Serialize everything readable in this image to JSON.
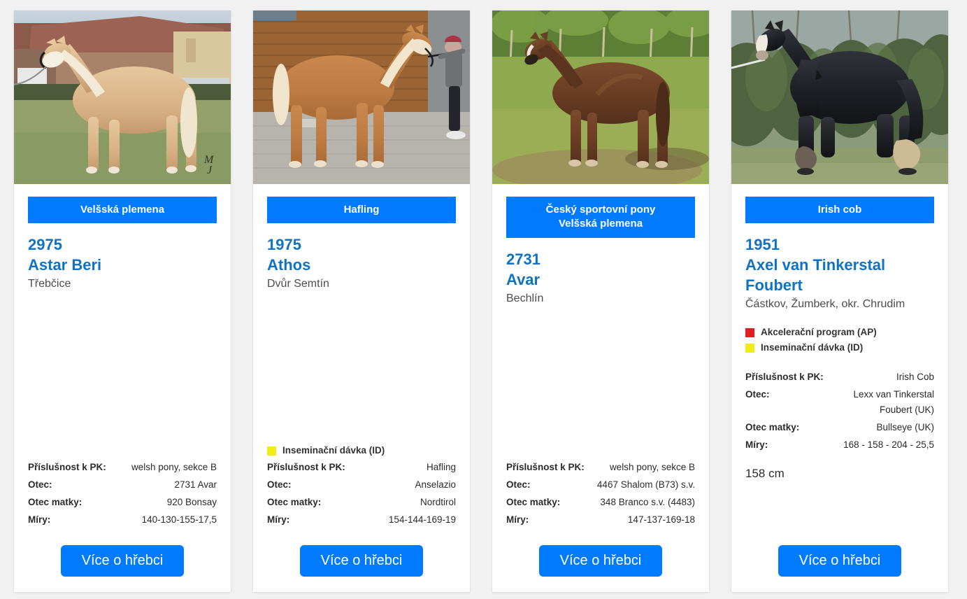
{
  "page": {
    "background_color": "#f1f1f1",
    "accent_color": "#007bff",
    "title_color": "#0f72c4"
  },
  "legend_colors": {
    "akceleracni_program": "#e02020",
    "inseminacni_davka": "#f2ec16"
  },
  "spec_labels": {
    "pk": "Příslušnost k PK:",
    "otec": "Otec:",
    "otec_matky": "Otec matky:",
    "miry": "Míry:"
  },
  "cta_label": "Více o hřebci",
  "cards": [
    {
      "photo_name": "palomino-stallion-photo",
      "photo_alt": "palomino-horse",
      "breed_lines": [
        "Velšská plemena"
      ],
      "stud_number": "2975",
      "stud_name": "Astar Beri",
      "place": "Třebčice",
      "flags": [],
      "specs": {
        "pk": "welsh pony, sekce B",
        "otec": "2731 Avar",
        "otec_matky": "920 Bonsay",
        "miry": "140-130-155-17,5"
      },
      "height_note": "",
      "cta": "Více o hřebci"
    },
    {
      "photo_name": "haflinger-stallion-photo",
      "photo_alt": "haflinger-horse",
      "breed_lines": [
        "Hafling"
      ],
      "stud_number": "1975",
      "stud_name": "Athos",
      "place": "Dvůr Semtín",
      "flags": [
        {
          "color": "#f2ec16",
          "label": "Inseminační dávka (ID)",
          "name": "inseminacni-davka"
        }
      ],
      "specs": {
        "pk": "Hafling",
        "otec": "Anselazio",
        "otec_matky": "Nordtirol",
        "miry": "154-144-169-19"
      },
      "height_note": "",
      "cta": "Více o hřebci"
    },
    {
      "photo_name": "chestnut-stallion-photo",
      "photo_alt": "chestnut-horse",
      "breed_lines": [
        "Český sportovní pony",
        "Velšská plemena"
      ],
      "stud_number": "2731",
      "stud_name": "Avar",
      "place": "Bechlín",
      "flags": [],
      "specs": {
        "pk": "welsh pony, sekce B",
        "otec": "4467 Shalom (B73) s.v.",
        "otec_matky": "348 Branco s.v. (4483)",
        "miry": "147-137-169-18"
      },
      "height_note": "",
      "cta": "Více o hřebci"
    },
    {
      "photo_name": "irish-cob-stallion-photo",
      "photo_alt": "black-irish-cob-horse",
      "breed_lines": [
        "Irish cob"
      ],
      "stud_number": "1951",
      "stud_name": "Axel van Tinkerstal Foubert",
      "place": "Částkov, Žumberk, okr. Chrudim",
      "flags": [
        {
          "color": "#e02020",
          "label": "Akcelerační program (AP)",
          "name": "akceleracni-program"
        },
        {
          "color": "#f2ec16",
          "label": "Inseminační dávka (ID)",
          "name": "inseminacni-davka"
        }
      ],
      "specs": {
        "pk": "Irish Cob",
        "otec": "Lexx van Tinkerstal Foubert (UK)",
        "otec_matky": "Bullseye (UK)",
        "miry": "168 - 158 - 204 - 25,5"
      },
      "height_note": "158 cm",
      "cta": "Více o hřebci"
    }
  ]
}
